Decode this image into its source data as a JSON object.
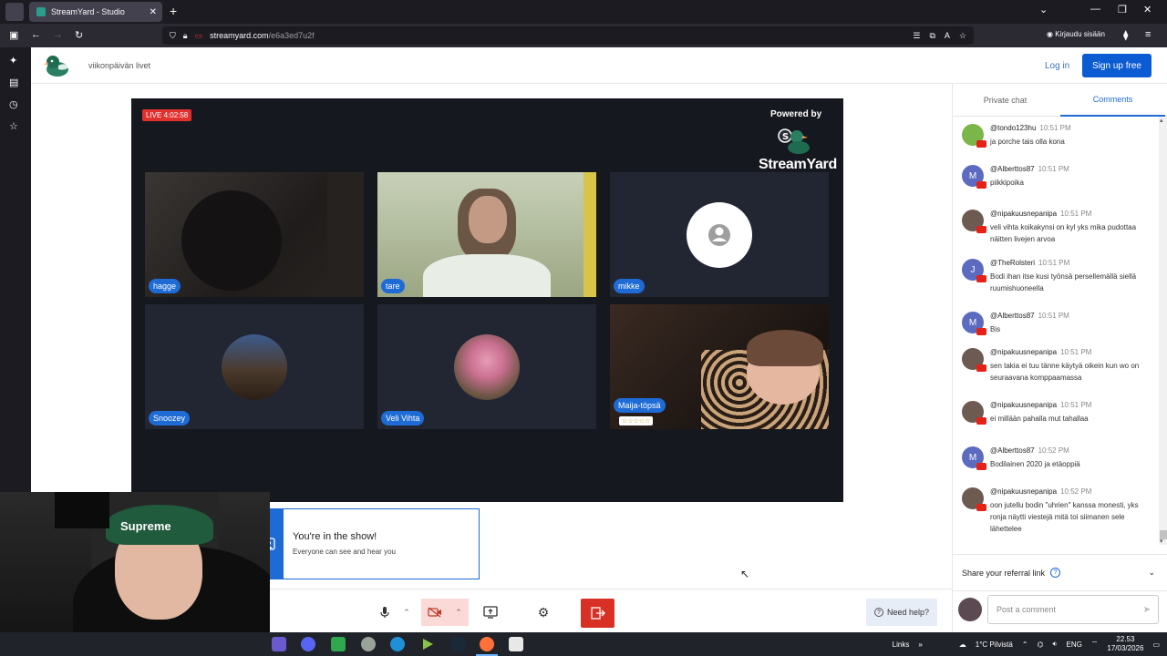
{
  "browser": {
    "tab_title": "StreamYard - Studio",
    "tab_close": "✕",
    "new_tab": "+",
    "url_host": "streamyard.com",
    "url_path": "/e6a3ed7u2f",
    "signin": "Kirjaudu sisään"
  },
  "header": {
    "page_name": "viikonpäivän livet",
    "login": "Log in",
    "signup": "Sign up free"
  },
  "stage": {
    "live_badge": "LIVE 4:02:58",
    "powered_by": "Powered by",
    "brand": "StreamYard",
    "participants": [
      {
        "name": "hagge"
      },
      {
        "name": "tare"
      },
      {
        "name": "mikke"
      },
      {
        "name": "Snoozey"
      },
      {
        "name": "Veli Vihta"
      },
      {
        "name": "Maija-töpsä",
        "stars": "☆☆☆☆☆"
      }
    ]
  },
  "toast": {
    "title": "You're in the show!",
    "subtitle": "Everyone can see and hear you"
  },
  "controls": {
    "need_help": "Need help?"
  },
  "panel": {
    "tab_private": "Private chat",
    "tab_comments": "Comments",
    "comments": [
      {
        "user": "@tondo123hu",
        "time": "10:51 PM",
        "text": "ja porche tais olla kona",
        "avatar": "#7ab648",
        "initial": ""
      },
      {
        "user": "@Alberttos87",
        "time": "10:51 PM",
        "text": "piikkipoika",
        "avatar": "#5c6bc0",
        "initial": "M"
      },
      {
        "user": "@nipakuusnepanipa",
        "time": "10:51 PM",
        "text": "veli vihta koikakynsi on kyl yks mika pudottaa näitten livejen arvoa",
        "avatar": "#6d5a50",
        "initial": ""
      },
      {
        "user": "@TheRolsteri",
        "time": "10:51 PM",
        "text": "Bodi ihan itse kusi työnsä persellemällä siellä ruumishuoneella",
        "avatar": "#5c6bc0",
        "initial": "J"
      },
      {
        "user": "@Alberttos87",
        "time": "10:51 PM",
        "text": "Bis",
        "avatar": "#5c6bc0",
        "initial": "M"
      },
      {
        "user": "@nipakuusnepanipa",
        "time": "10:51 PM",
        "text": "sen takia ei tuu tänne käytyä oikein kun wo on seuraavana komppaamassa",
        "avatar": "#6d5a50",
        "initial": ""
      },
      {
        "user": "@nipakuusnepanipa",
        "time": "10:51 PM",
        "text": "ei millään pahalla mut tahallaa",
        "avatar": "#6d5a50",
        "initial": ""
      },
      {
        "user": "@Alberttos87",
        "time": "10:52 PM",
        "text": "Bodilainen 2020 ja etäoppiä",
        "avatar": "#5c6bc0",
        "initial": "M"
      },
      {
        "user": "@nipakuusnepanipa",
        "time": "10:52 PM",
        "text": "oon jutellu bodin \"uhrien\" kanssa monesti, yks ronja näytti viestejä mitä toi siimanen sele lähettelee",
        "avatar": "#6d5a50",
        "initial": ""
      }
    ],
    "referral": "Share your referral link",
    "comment_placeholder": "Post a comment"
  },
  "webcam": {
    "cap_text": "Supreme"
  },
  "taskbar": {
    "links": "Links",
    "weather": "1°C Pilvistä",
    "lang": "ENG",
    "time": "22.53",
    "date": "17/03/2026"
  }
}
